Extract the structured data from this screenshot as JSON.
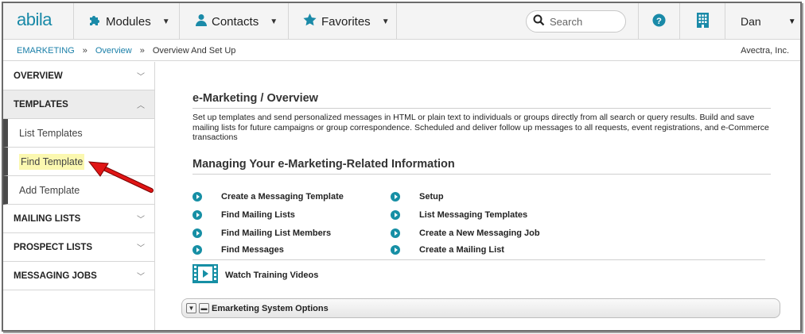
{
  "brand": {
    "logo_text": "abila",
    "accent_color": "#1a8aa8"
  },
  "topnav": {
    "menus": [
      {
        "label": "Modules",
        "icon": "puzzle-icon"
      },
      {
        "label": "Contacts",
        "icon": "person-icon"
      },
      {
        "label": "Favorites",
        "icon": "star-icon"
      }
    ],
    "search_placeholder": "Search",
    "help_icon": "help-icon",
    "org_icon": "building-icon",
    "user_name": "Dan"
  },
  "breadcrumb": {
    "items": [
      "EMARKETING",
      "Overview",
      "Overview And Set Up"
    ],
    "separator": "»",
    "org_name": "Avectra, Inc."
  },
  "sidebar": {
    "overview": "OVERVIEW",
    "templates": "TEMPLATES",
    "template_items": [
      "List Templates",
      "Find Template",
      "Add Template"
    ],
    "highlighted_item": "Find Template",
    "highlight_color": "#fbf8b0",
    "mailing_lists": "MAILING LISTS",
    "prospect_lists": "PROSPECT LISTS",
    "messaging_jobs": "MESSAGING JOBS"
  },
  "main": {
    "title": "e-Marketing / Overview",
    "description": "Set up templates and send personalized messages in HTML or plain text to individuals or groups directly from all search or query results. Build and save mailing lists for future campaigns or group correspondence. Scheduled and deliver follow up messages to all requests, event registrations, and e-Commerce transactions",
    "section_title": "Managing Your e-Marketing-Related Information",
    "links_left": [
      "Create a Messaging Template",
      "Find Mailing Lists",
      "Find Mailing List Members",
      "Find Messages"
    ],
    "links_right": [
      "Setup",
      "List Messaging Templates",
      "Create a New Messaging Job",
      "Create a Mailing List"
    ],
    "video_label": "Watch Training Videos",
    "options_label": "Emarketing System Options"
  }
}
